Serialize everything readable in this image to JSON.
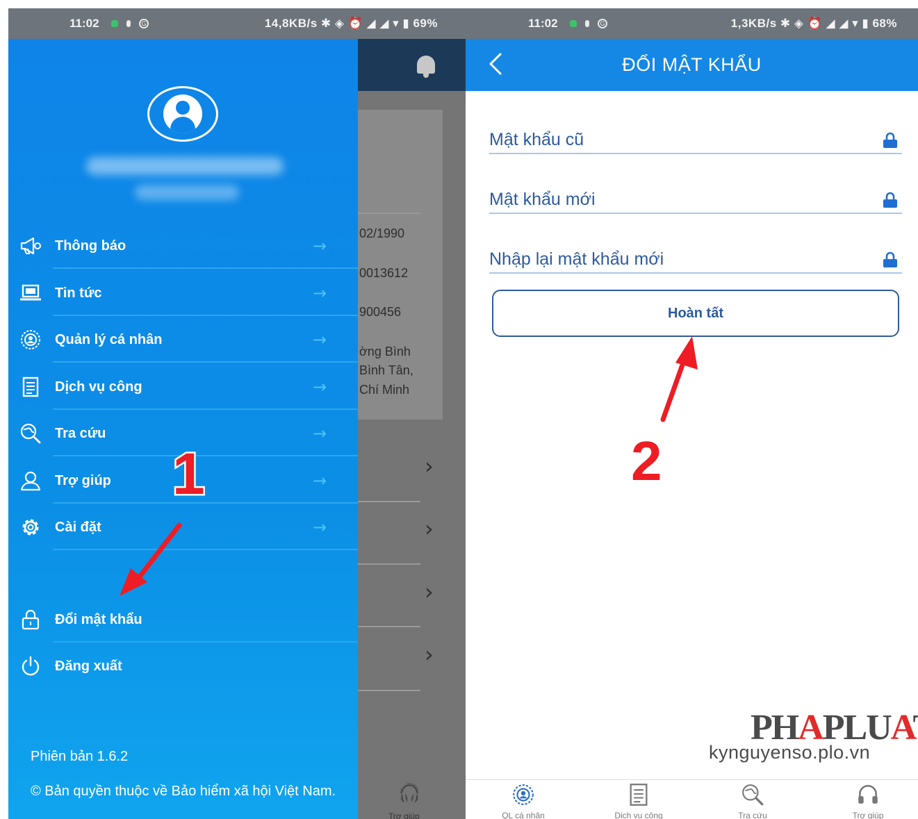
{
  "left_phone": {
    "status": {
      "time": "11:02",
      "right": "14,8KB/s ✱ ◈ ⏰ ◢ ◢ ▾ ▮ 69%"
    },
    "background_app": {
      "rows": [
        "02/1990",
        "0013612",
        "900456"
      ],
      "address": [
        "ờng Bình",
        "Bình Tân,",
        "Chí Minh"
      ],
      "bottom_nav_label": "Trợ giúp"
    },
    "drawer": {
      "menu": [
        {
          "label": "Thông báo",
          "icon": "megaphone-icon"
        },
        {
          "label": "Tin tức",
          "icon": "laptop-icon"
        },
        {
          "label": "Quản lý cá nhân",
          "icon": "profile-badge-icon"
        },
        {
          "label": "Dịch vụ công",
          "icon": "document-icon"
        },
        {
          "label": "Tra cứu",
          "icon": "search-globe-icon"
        },
        {
          "label": "Trợ giúp",
          "icon": "support-person-icon"
        },
        {
          "label": "Cài đặt",
          "icon": "gear-icon"
        }
      ],
      "change_password": "Đổi mật khẩu",
      "logout": "Đăng xuất",
      "version": "Phiên bản 1.6.2",
      "copyright": "© Bản quyền thuộc về  Bảo hiểm xã hội Việt Nam."
    },
    "annotation_number": "1"
  },
  "right_phone": {
    "status": {
      "time": "11:02",
      "right": "1,3KB/s ✱ ◈ ⏰ ◢ ◢ ▾ ▮ 68%"
    },
    "header_title": "ĐỔI MẬT KHẨU",
    "fields": {
      "old_password": "Mật khẩu cũ",
      "new_password": "Mật khẩu mới",
      "confirm_password": "Nhập lại mật khẩu mới"
    },
    "submit_label": "Hoàn tất",
    "annotation_number": "2",
    "brand": {
      "logo_prefix": "PH",
      "logo_a": "A",
      "logo_mid": "PLU",
      "logo_a2": "A",
      "logo_suffix": "T",
      "site": "kynguyenso.plo.vn"
    },
    "bottom_nav": [
      "QL cá nhân",
      "Dịch vụ công",
      "Tra cứu",
      "Trợ giúp"
    ]
  },
  "colors": {
    "drawer_blue": "#0e84e8",
    "header_blue": "#1588e5",
    "field_text": "#2d5aa0",
    "annotation_red": "#ee1c24"
  }
}
